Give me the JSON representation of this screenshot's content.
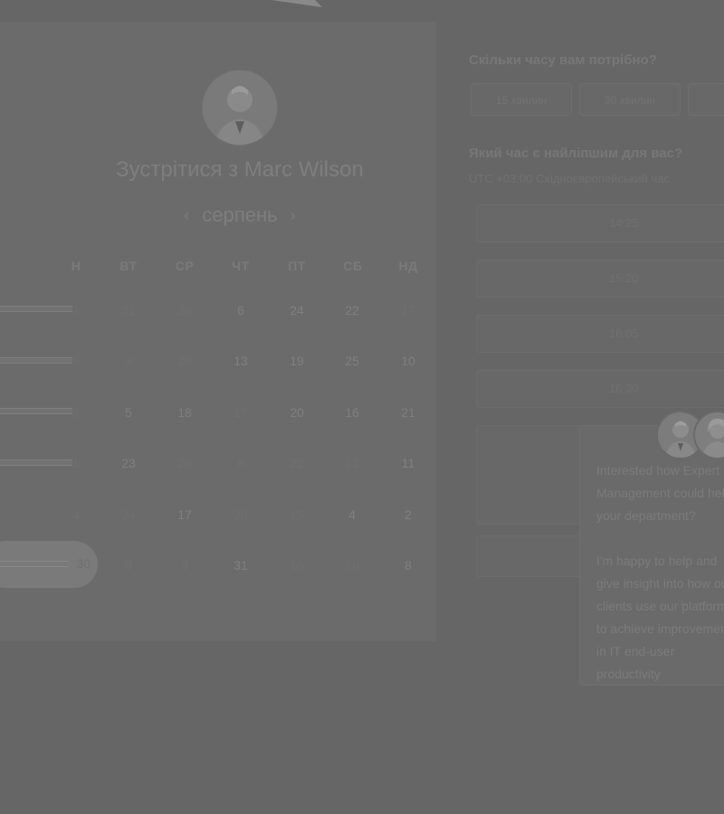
{
  "booking": {
    "title": "Зустрітися з Marc Wilson",
    "month": "серпень",
    "prev_month_icon": "chevron-left-icon",
    "next_month_icon": "chevron-right-icon",
    "weekdays": [
      "Н",
      "ВТ",
      "СР",
      "ЧТ",
      "ПТ",
      "СБ",
      "НД"
    ],
    "weeks": [
      [
        "9",
        "31",
        "20",
        "6",
        "24",
        "22",
        "17"
      ],
      [
        "9",
        "3",
        "25",
        "13",
        "19",
        "25",
        "10"
      ],
      [
        "6",
        "5",
        "18",
        "17",
        "20",
        "16",
        "21"
      ],
      [
        "1",
        "23",
        "29",
        "8",
        "22",
        "12",
        "11"
      ],
      [
        "4",
        "24",
        "17",
        "20",
        "15",
        "4",
        "2"
      ],
      [
        "30",
        "9",
        "9",
        "31",
        "10",
        "10",
        "8"
      ]
    ]
  },
  "duration": {
    "title": "Скільки часу вам потрібно?",
    "options": [
      "15 хвилин",
      "30 хвилин"
    ]
  },
  "time": {
    "title": "Який час є найліпшим для вас?",
    "timezone": "UTC +03:00 Східноєвропейський час",
    "slots": [
      "14:25",
      "15:20",
      "16:05",
      "16:30"
    ]
  },
  "chat": {
    "message1": "Interested how Expert Management could help your department?",
    "message2": "I'm happy to help and give insight into how our clients use our platform to achieve improvement in IT end-user productivity"
  }
}
